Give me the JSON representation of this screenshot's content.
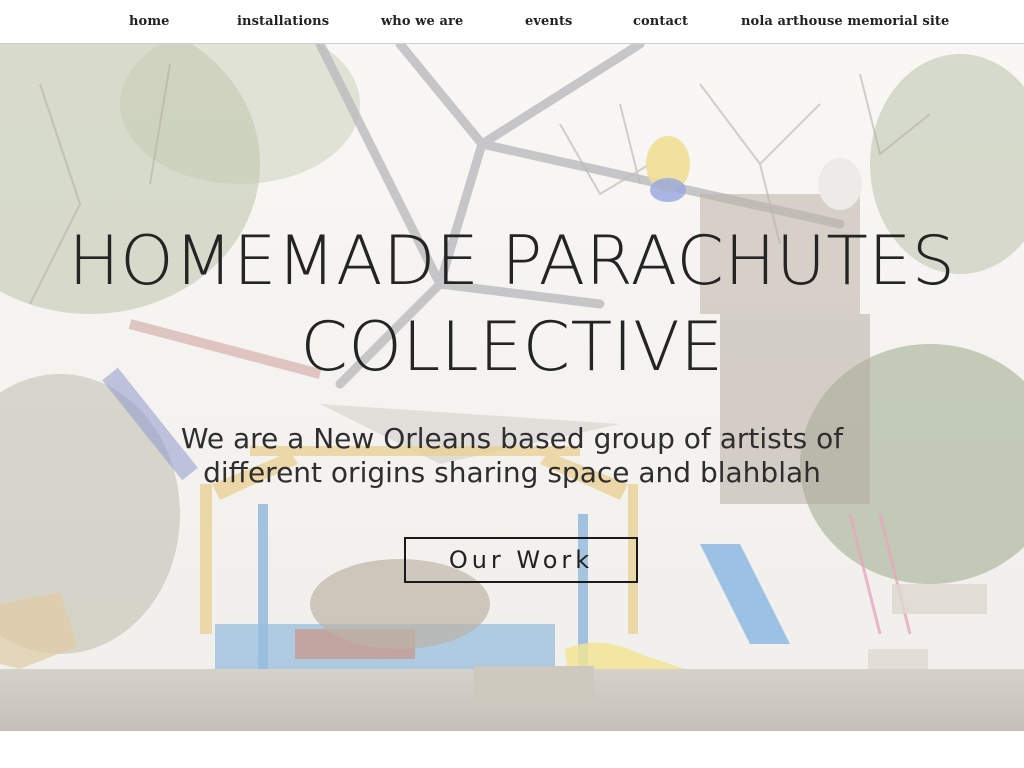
{
  "nav": {
    "items": [
      {
        "label": "home"
      },
      {
        "label": "installations"
      },
      {
        "label": "who we are"
      },
      {
        "label": "events"
      },
      {
        "label": "contact"
      },
      {
        "label": "nola arthouse memorial site"
      }
    ]
  },
  "hero": {
    "title_line1": "HOMEMADE PARACHUTES",
    "title_line2": "COLLECTIVE",
    "tagline_line1": "We are a New Orleans based group of artists of",
    "tagline_line2": "different origins sharing space and blahblah",
    "cta_label": "Our Work"
  },
  "colors": {
    "text": "#242424",
    "nav_border": "#cfcfcf",
    "overlay": "rgba(255,255,255,0.42)"
  }
}
